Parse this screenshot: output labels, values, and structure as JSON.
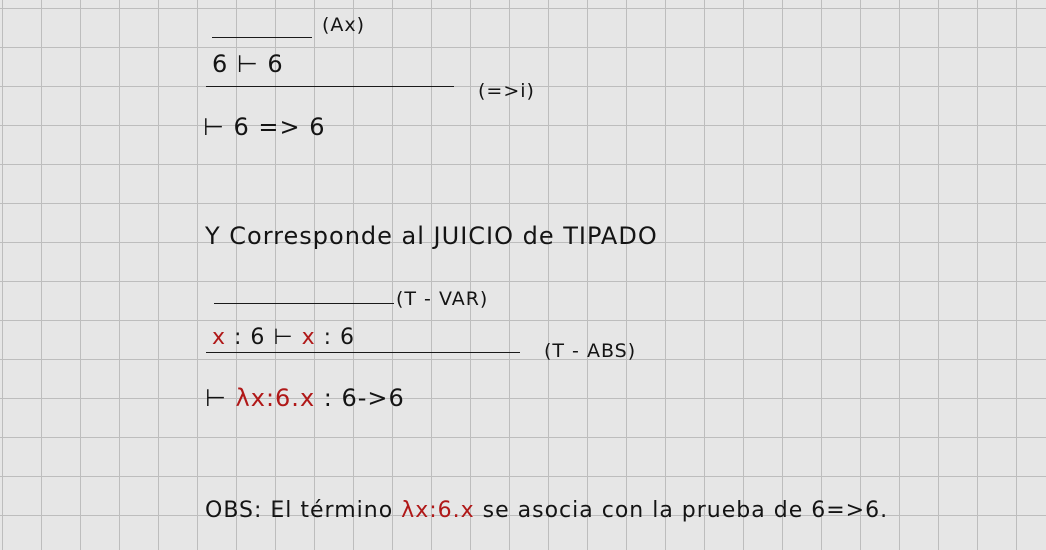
{
  "proof1": {
    "rule_top": "(Ax)",
    "line1": "6 ⊢ 6",
    "rule_bottom": "(=>i)",
    "conclusion": "⊢ 6 => 6"
  },
  "statement": {
    "text": "Y Corresponde al JUICIO de TIPADO"
  },
  "proof2": {
    "rule_top": "(T - VAR)",
    "line1_red": "x",
    "line1_mid": ": 6 ⊢",
    "line1_red2": "x",
    "line1_end": ": 6",
    "rule_bottom": "(T - ABS)",
    "conclusion_turnstile": "⊢",
    "conclusion_term": "λx:6.x",
    "conclusion_type": ": 6->6"
  },
  "obs": {
    "prefix": "OBS: El término",
    "term": "λx:6.x",
    "suffix": "se asocia con la prueba de 6=>6."
  },
  "colors": {
    "ink": "#141414",
    "red_ink": "#b01818",
    "grid": "#bdbdbd",
    "paper": "#e6e6e6"
  }
}
